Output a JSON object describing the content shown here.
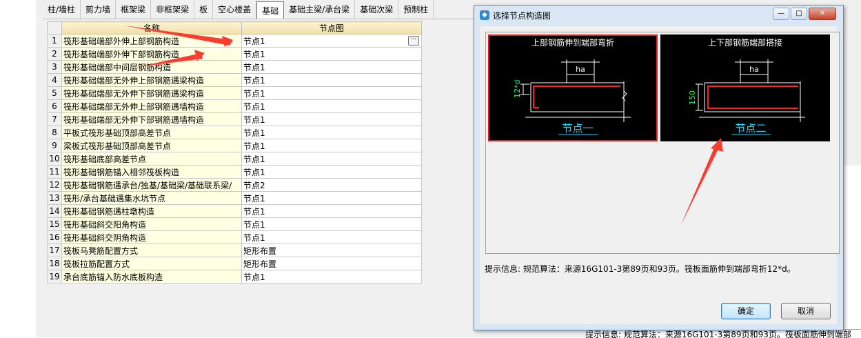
{
  "tabs": [
    "柱/墙柱",
    "剪力墙",
    "框架梁",
    "非框架梁",
    "板",
    "空心楼盖",
    "基础",
    "基础主梁/承台梁",
    "基础次梁",
    "预制柱"
  ],
  "active_tab": "基础",
  "table": {
    "headers": [
      "名称",
      "节点图"
    ],
    "rows": [
      {
        "n": "1",
        "name": "筏形基础端部外伸上部钢筋构造",
        "val": "节点1"
      },
      {
        "n": "2",
        "name": "筏形基础端部外伸下部钢筋构造",
        "val": "节点1"
      },
      {
        "n": "3",
        "name": "筏形基础端部中间层钢筋构造",
        "val": "节点1"
      },
      {
        "n": "4",
        "name": "筏形基础端部无外伸上部钢筋遇梁构造",
        "val": "节点1"
      },
      {
        "n": "5",
        "name": "筏形基础端部无外伸下部钢筋遇梁构造",
        "val": "节点1"
      },
      {
        "n": "6",
        "name": "筏形基础端部无外伸上部钢筋遇墙构造",
        "val": "节点1"
      },
      {
        "n": "7",
        "name": "筏形基础端部无外伸下部钢筋遇墙构造",
        "val": "节点1"
      },
      {
        "n": "8",
        "name": "平板式筏形基础顶部高差节点",
        "val": "节点1"
      },
      {
        "n": "9",
        "name": "梁板式筏形基础顶部高差节点",
        "val": "节点1"
      },
      {
        "n": "10",
        "name": "筏形基础底部高差节点",
        "val": "节点1"
      },
      {
        "n": "11",
        "name": "筏形基础钢筋锚入相邻筏板构造",
        "val": "节点1"
      },
      {
        "n": "12",
        "name": "筏形基础钢筋遇承台/独基/基础梁/基础联系梁/",
        "val": "节点2"
      },
      {
        "n": "13",
        "name": "筏形/承台基础遇集水坑节点",
        "val": "节点1"
      },
      {
        "n": "14",
        "name": "筏形基础钢筋遇柱墩构造",
        "val": "节点1"
      },
      {
        "n": "15",
        "name": "筏形基础斜交阳角构造",
        "val": "节点1"
      },
      {
        "n": "16",
        "name": "筏形基础斜交阴角构造",
        "val": "节点1"
      },
      {
        "n": "17",
        "name": "筏板马凳筋配置方式",
        "val": "矩形布置"
      },
      {
        "n": "18",
        "name": "筏板拉筋配置方式",
        "val": "矩形布置"
      },
      {
        "n": "19",
        "name": "承台底筋锚入防水底板构造",
        "val": "节点1"
      }
    ]
  },
  "dialog": {
    "title": "选择节点构造图",
    "previews": [
      {
        "title": "上部钢筋伸到端部弯折",
        "caption": "节点一",
        "dim_label": "12*d",
        "ha": "ha",
        "selected": true
      },
      {
        "title": "上下部钢筋端部搭接",
        "caption": "节点二",
        "dim_label": "150",
        "ha": "ha",
        "selected": false
      }
    ],
    "info": "提示信息:  规范算法：来源16G101-3第89页和93页。筏板面筋伸到端部弯折12*d。",
    "ok": "确定",
    "cancel": "取消"
  },
  "bottom_peek": "提示信息:  规范算法：来源16G101-3第89页和93页。筏板面筋伸到端部",
  "colors": {
    "selection": "#e02020",
    "drawing_bg": "#000000",
    "rebar": "#ff2020",
    "caption": "#00e0ff",
    "dim": "#00ff66"
  }
}
